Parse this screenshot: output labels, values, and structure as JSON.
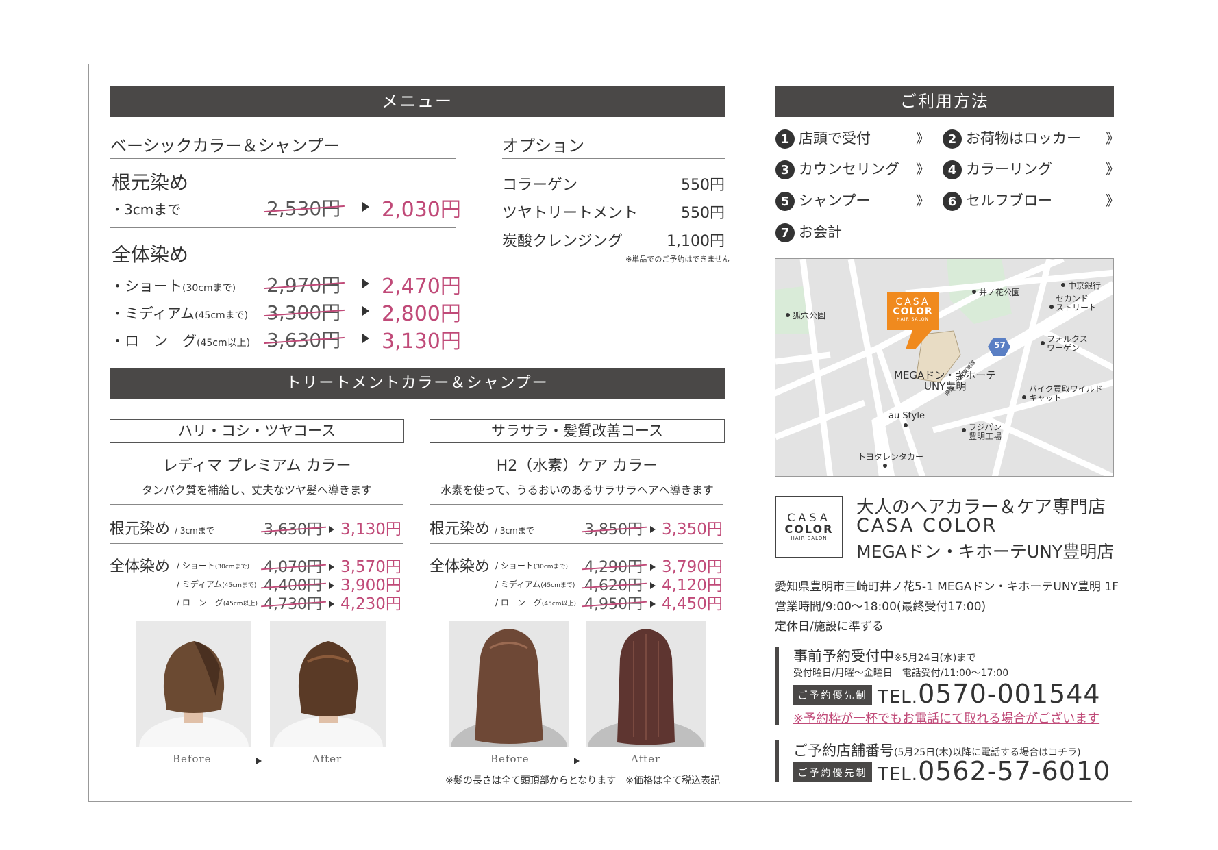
{
  "menu": {
    "title": "メニュー"
  },
  "basic": {
    "heading": "ベーシックカラー＆シャンプー",
    "root": {
      "title": "根元染め",
      "label": "・3cmまで",
      "old": "2,530円",
      "new": "2,030円"
    },
    "full": {
      "title": "全体染め",
      "rows": [
        {
          "label": "・ショート",
          "note": "(30cmまで)",
          "old": "2,970円",
          "new": "2,470円"
        },
        {
          "label": "・ミディアム",
          "note": "(45cmまで)",
          "old": "3,300円",
          "new": "2,800円"
        },
        {
          "label": "・ロ　ン　グ",
          "note": "(45cm以上)",
          "old": "3,630円",
          "new": "3,130円"
        }
      ]
    }
  },
  "option": {
    "heading": "オプション",
    "items": [
      {
        "name": "コラーゲン",
        "price": "550円"
      },
      {
        "name": "ツヤトリートメント",
        "price": "550円"
      },
      {
        "name": "炭酸クレンジング",
        "price": "1,100円"
      }
    ],
    "note": "※単品でのご予約はできません"
  },
  "treatment": {
    "title": "トリートメントカラー＆シャンプー",
    "courses": [
      {
        "box": "ハリ・コシ・ツヤコース",
        "name": "レディマ プレミアム カラー",
        "desc": "タンパク質を補給し、丈夫なツヤ髪へ導きます",
        "root_label": "根元染め",
        "root_note": "/ 3cmまで",
        "root_old": "3,630円",
        "root_new": "3,130円",
        "full_label": "全体染め",
        "rows": [
          {
            "label": "/ ショート",
            "note": "(30cmまで)",
            "old": "4,070円",
            "new": "3,570円"
          },
          {
            "label": "/ ミディアム",
            "note": "(45cmまで)",
            "old": "4,400円",
            "new": "3,900円"
          },
          {
            "label": "/ ロ　ン　グ",
            "note": "(45cm以上)",
            "old": "4,730円",
            "new": "4,230円"
          }
        ],
        "before": "Before",
        "after": "After"
      },
      {
        "box": "サラサラ・髪質改善コース",
        "name": "H2（水素）ケア カラー",
        "desc": "水素を使って、うるおいのあるサラサラヘアへ導きます",
        "root_label": "根元染め",
        "root_note": "/ 3cmまで",
        "root_old": "3,850円",
        "root_new": "3,350円",
        "full_label": "全体染め",
        "rows": [
          {
            "label": "/ ショート",
            "note": "(30cmまで)",
            "old": "4,290円",
            "new": "3,790円"
          },
          {
            "label": "/ ミディアム",
            "note": "(45cmまで)",
            "old": "4,620円",
            "new": "4,120円"
          },
          {
            "label": "/ ロ　ン　グ",
            "note": "(45cm以上)",
            "old": "4,950円",
            "new": "4,450円"
          }
        ],
        "before": "Before",
        "after": "After"
      }
    ],
    "footnote": "※髪の長さは全て頭頂部からとなります　※価格は全て税込表記"
  },
  "usage": {
    "title": "ご利用方法",
    "steps": [
      {
        "n": "1",
        "t": "店頭で受付"
      },
      {
        "n": "2",
        "t": "お荷物はロッカー"
      },
      {
        "n": "3",
        "t": "カウンセリング"
      },
      {
        "n": "4",
        "t": "カラーリング"
      },
      {
        "n": "5",
        "t": "シャンプー"
      },
      {
        "n": "6",
        "t": "セルフブロー"
      },
      {
        "n": "7",
        "t": "お会計"
      }
    ],
    "arrow": "》"
  },
  "map": {
    "logo": [
      "CASA",
      "COLOR",
      "HAIR SALON"
    ],
    "route": "57",
    "labels": {
      "inoha": "井ノ花公園",
      "chukyo": "中京銀行",
      "second": "セカンド\nストリート",
      "kitsune": "狐穴公園",
      "vw": "フォルクス\nワーゲン",
      "mega": "MEGAドン・キホーテ\nUNY豊明",
      "bike": "バイク買取ワイルド\nキャット",
      "au": "au Style",
      "road": "県道・大府東海線",
      "fujipan": "フジパン\n豊明工場",
      "toyota": "トヨタレンタカー"
    }
  },
  "shop": {
    "logo": [
      "CASA",
      "COLOR",
      "HAIR SALON"
    ],
    "tagline": "大人のヘアカラー＆ケア専門店",
    "name": "CASA COLOR",
    "branch": "MEGAドン・キホーテUNY豊明店",
    "address": "愛知県豊明市三崎町井ノ花5-1 MEGAドン・キホーテUNY豊明 1F",
    "hours": "営業時間/9:00〜18:00(最終受付17:00)",
    "holiday": "定休日/施設に準ずる"
  },
  "reserve": {
    "title": "事前予約受付中",
    "until": "※5月24日(水)まで",
    "days": "受付曜日/月曜〜金曜日　電話受付/11:00〜17:00",
    "badge": "ご予約優先制",
    "tel_prefix": "TEL.",
    "tel": "0570-001544",
    "warn": "※予約枠が一杯でもお電話にて取れる場合がございます"
  },
  "store": {
    "title": "ご予約店舗番号",
    "note": "(5月25日(木)以降に電話する場合はコチラ)",
    "badge": "ご予約優先制",
    "tel_prefix": "TEL.",
    "tel": "0562-57-6010"
  }
}
